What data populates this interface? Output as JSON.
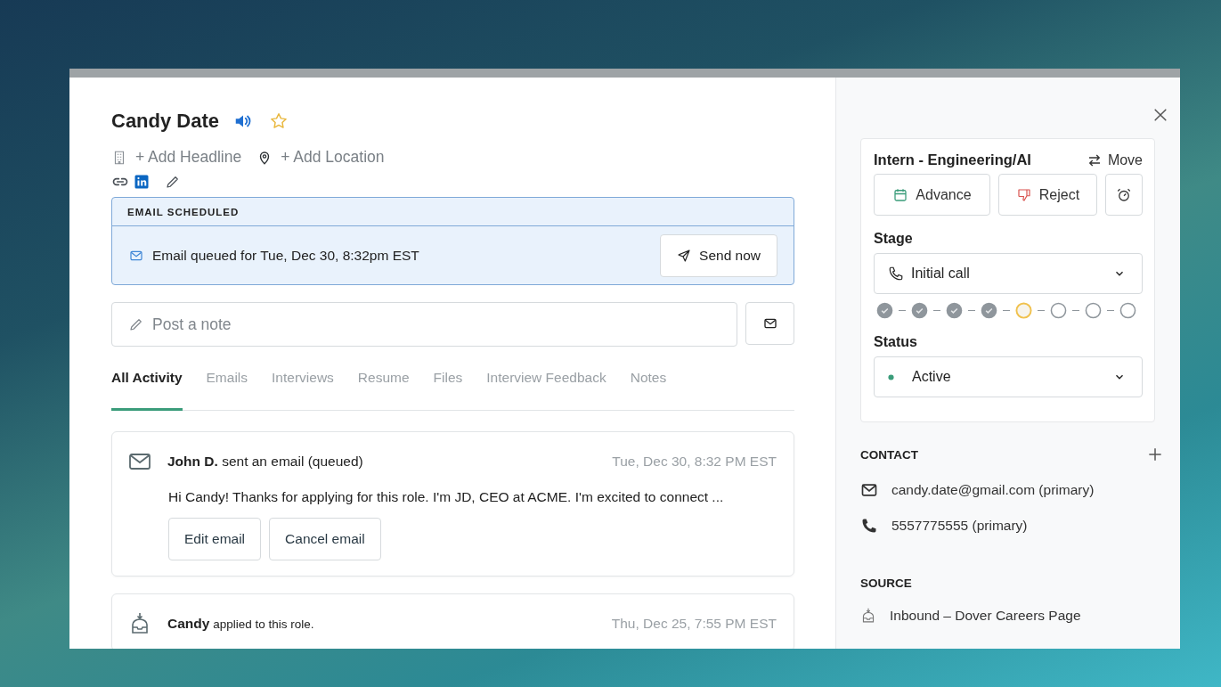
{
  "candidate": {
    "name": "Candy Date"
  },
  "profile_links": [
    {
      "kind": "building",
      "label": "+ Add Headline"
    },
    {
      "kind": "pin",
      "label": "+ Add Location"
    }
  ],
  "scheduled": {
    "heading": "EMAIL SCHEDULED",
    "message": "Email queued for Tue, Dec 30, 8:32pm EST",
    "button": "Send now"
  },
  "note": {
    "placeholder": "Post a note"
  },
  "tabs": [
    {
      "label": "All Activity",
      "selected": true
    },
    {
      "label": "Emails",
      "selected": false
    },
    {
      "label": "Interviews",
      "selected": false
    },
    {
      "label": "Resume",
      "selected": false
    },
    {
      "label": "Files",
      "selected": false
    },
    {
      "label": "Interview Feedback",
      "selected": false
    },
    {
      "label": "Notes",
      "selected": false
    }
  ],
  "activity": [
    {
      "kind": "email",
      "actor": "John D.",
      "action": "sent an email (queued)",
      "time": "Tue, Dec 30, 8:32 PM EST",
      "body": "Hi Candy! Thanks for applying for this role. I'm JD, CEO at ACME. I'm excited to connect ...",
      "buttons": [
        "Edit email",
        "Cancel email"
      ]
    },
    {
      "kind": "applied",
      "actor": "Candy",
      "action": "applied to this role.",
      "time": "Thu, Dec 25, 7:55 PM EST"
    }
  ],
  "job": {
    "title": "Intern - Engineering/AI",
    "move": "Move",
    "advance": "Advance",
    "reject": "Reject",
    "stage_label": "Stage",
    "stage": "Initial call",
    "steps": [
      {
        "done": true,
        "current": false
      },
      {
        "done": true,
        "current": false
      },
      {
        "done": true,
        "current": false
      },
      {
        "done": true,
        "current": false
      },
      {
        "done": false,
        "current": true
      },
      {
        "done": false,
        "current": false
      },
      {
        "done": false,
        "current": false
      },
      {
        "done": false,
        "current": false
      }
    ],
    "status_label": "Status",
    "status": "Active"
  },
  "contact": {
    "heading": "CONTACT",
    "items": [
      {
        "kind": "email",
        "text": "candy.date@gmail.com (primary)"
      },
      {
        "kind": "phone",
        "text": "5557775555 (primary)"
      }
    ]
  },
  "source": {
    "heading": "SOURCE",
    "items": [
      {
        "text": "Inbound – Dover Careers Page"
      }
    ]
  }
}
